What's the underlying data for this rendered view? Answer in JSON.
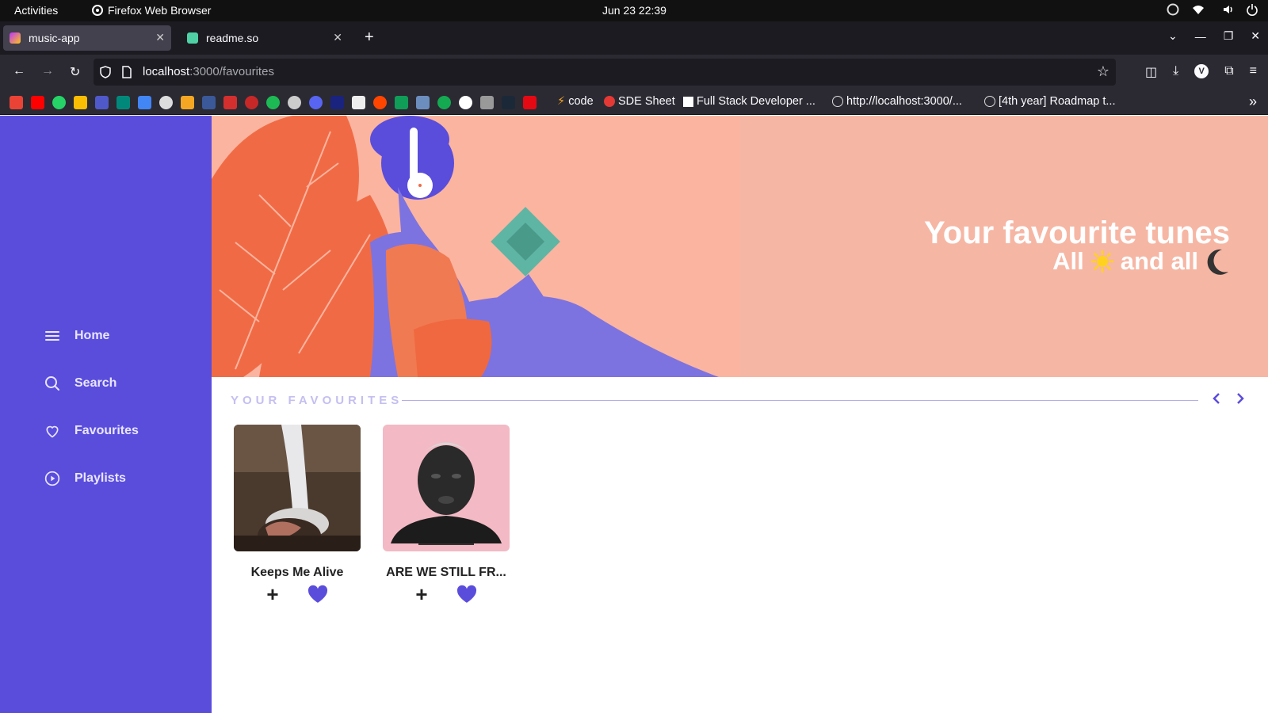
{
  "system": {
    "activities": "Activities",
    "app_name": "Firefox Web Browser",
    "clock": "Jun 23  22:39"
  },
  "browser": {
    "tabs": [
      {
        "title": "music-app",
        "active": true
      },
      {
        "title": "readme.so",
        "active": false
      }
    ],
    "url_host": "localhost",
    "url_path": ":3000/favourites",
    "bookmarks": [
      {
        "label": "code"
      },
      {
        "label": "SDE Sheet"
      },
      {
        "label": "Full Stack Developer ..."
      },
      {
        "label": "http://localhost:3000/..."
      },
      {
        "label": "[4th year] Roadmap t..."
      }
    ]
  },
  "sidebar": {
    "items": [
      {
        "label": "Home",
        "icon": "menu-icon"
      },
      {
        "label": "Search",
        "icon": "search-icon"
      },
      {
        "label": "Favourites",
        "icon": "heart-icon"
      },
      {
        "label": "Playlists",
        "icon": "play-circle-icon"
      }
    ]
  },
  "hero": {
    "title": "Your favourite tunes",
    "subtitle_before": "All",
    "subtitle_after": "and all",
    "sun_icon": "sun-icon",
    "moon_icon": "moon-icon"
  },
  "favourites": {
    "heading": "YOUR FAVOURITES",
    "items": [
      {
        "title": "Keeps Me Alive",
        "cover": "waterfall-cover"
      },
      {
        "title": "ARE WE STILL FR...",
        "cover": "portrait-cover"
      }
    ]
  },
  "colors": {
    "accent": "#5b4ddc",
    "hero_bg": "#fbb4a0"
  }
}
